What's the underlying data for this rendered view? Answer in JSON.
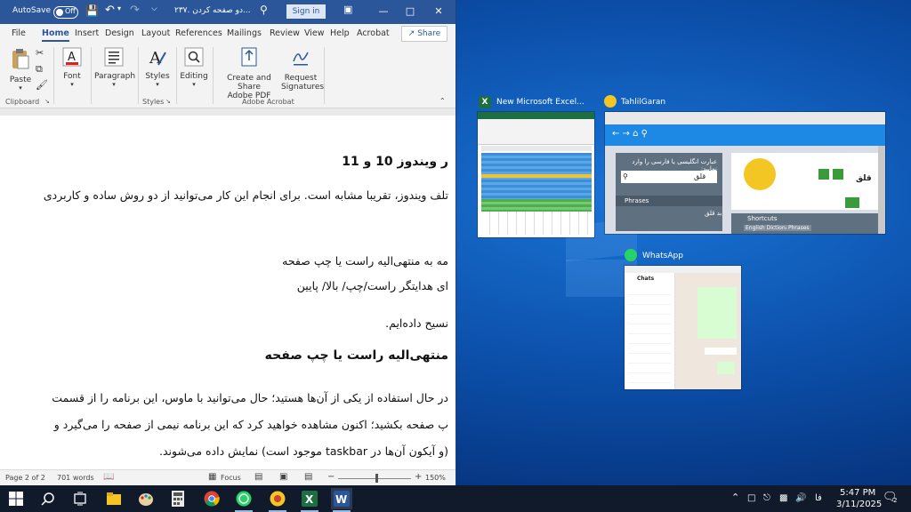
{
  "word": {
    "autosave_label": "AutoSave",
    "autosave_state": "Off",
    "doc_title": "۲۳۷. دو صفحه کردن...",
    "signin_label": "Sign in",
    "tabs": [
      "File",
      "Home",
      "Insert",
      "Design",
      "Layout",
      "References",
      "Mailings",
      "Review",
      "View",
      "Help",
      "Acrobat"
    ],
    "share_label": "Share",
    "ribbon": {
      "paste_label": "Paste",
      "clipboard_group": "Clipboard",
      "font_label": "Font",
      "paragraph_label": "Paragraph",
      "styles_label": "Styles",
      "styles_group": "Styles",
      "editing_label": "Editing",
      "create_share_label_1": "Create and Share",
      "create_share_label_2": "Adobe PDF",
      "request_sig_label_1": "Request",
      "request_sig_label_2": "Signatures",
      "acrobat_group": "Adobe Acrobat"
    },
    "doc_lines": [
      "ر ویندوز 10 و 11",
      "تلف ویندوز، تقریبا مشابه است. برای انجام این کار می‌توانید از دو روش ساده و کاربردی",
      "مه به منتهی‌الیه راست یا چپ صفحه",
      "ای هدایتگر راست/چپ/ بالا/ پایین",
      "نسیح داده‌ایم.",
      "منتهی‌الیه راست یا چپ صفحه",
      "در حال استفاده از یکی از آن‌ها هستید؛ حال می‌توانید با ماوس، این برنامه را از قسمت",
      "پ صفحه بکشید؛ اکنون مشاهده خواهید کرد که این برنامه نیمی از صفحه را می‌گیرد و",
      "(و آیکون آن‌ها در taskbar موجود است) نمایش داده می‌شوند."
    ],
    "status": {
      "page": "Page 2 of 2",
      "words": "701 words",
      "focus": "Focus",
      "zoom": "150%"
    }
  },
  "snap_thumbnails": [
    {
      "title": "New Microsoft Excel...",
      "icon": "excel-icon"
    },
    {
      "title": "TahlilGaran",
      "icon": "tahlilgaran-icon"
    },
    {
      "title": "WhatsApp",
      "icon": "whatsapp-icon"
    }
  ],
  "tahlil_preview": {
    "heading": "عبارت انگلیسی یا فارسی را وارد نمایید:",
    "query": "قلق",
    "phrases": "Phrases",
    "shortcuts": "Shortcuts",
    "result_word": "قلق",
    "suggestion": "بد قلق",
    "chip1": "English Dictionary",
    "chip2": "Phrases"
  },
  "whatsapp_preview": {
    "header": "Chats"
  },
  "taskbar": {
    "time": "5:47 PM",
    "date": "3/11/2025",
    "lang": "فا",
    "notif_count": "2"
  },
  "colors": {
    "word_blue": "#2b579a",
    "excel_green": "#1d6f42",
    "whatsapp_green": "#25d366",
    "desktop_blue": "#0b4ea8",
    "taskbar": "#101a2a"
  }
}
